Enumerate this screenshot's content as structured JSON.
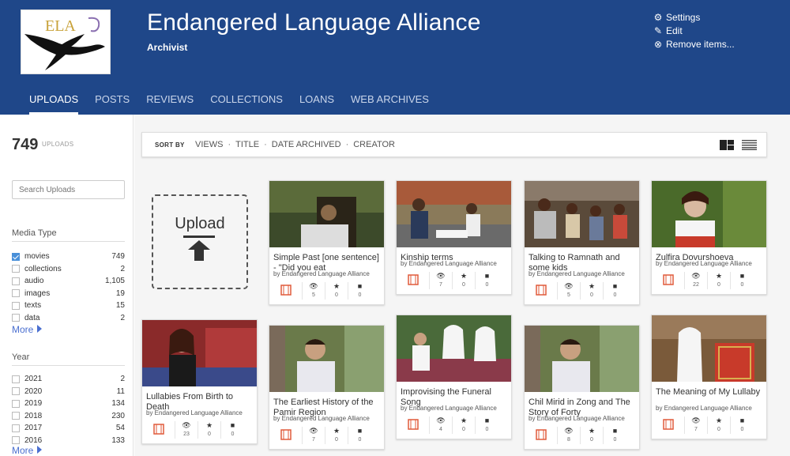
{
  "header": {
    "logo_text": "ELA",
    "title": "Endangered Language Alliance",
    "subtitle": "Archivist",
    "actions": [
      {
        "label": "Settings",
        "icon": "gear-icon"
      },
      {
        "label": "Edit",
        "icon": "pencil-icon"
      },
      {
        "label": "Remove items...",
        "icon": "remove-icon"
      }
    ]
  },
  "tabs": [
    "UPLOADS",
    "POSTS",
    "REVIEWS",
    "COLLECTIONS",
    "LOANS",
    "WEB ARCHIVES"
  ],
  "sidebar": {
    "count": "749",
    "count_label": "UPLOADS",
    "search_placeholder": "Search Uploads",
    "media_type": {
      "title": "Media Type",
      "items": [
        {
          "name": "movies",
          "count": "749",
          "checked": true
        },
        {
          "name": "collections",
          "count": "2",
          "checked": false
        },
        {
          "name": "audio",
          "count": "1,105",
          "checked": false
        },
        {
          "name": "images",
          "count": "19",
          "checked": false
        },
        {
          "name": "texts",
          "count": "15",
          "checked": false
        },
        {
          "name": "data",
          "count": "2",
          "checked": false
        }
      ],
      "more": "More"
    },
    "year": {
      "title": "Year",
      "items": [
        {
          "name": "2021",
          "count": "2"
        },
        {
          "name": "2020",
          "count": "11"
        },
        {
          "name": "2019",
          "count": "134"
        },
        {
          "name": "2018",
          "count": "230"
        },
        {
          "name": "2017",
          "count": "54"
        },
        {
          "name": "2016",
          "count": "133"
        }
      ],
      "more": "More"
    }
  },
  "sortbar": {
    "label": "SORT BY",
    "options": [
      "VIEWS",
      "TITLE",
      "DATE ARCHIVED",
      "CREATOR"
    ]
  },
  "upload_label": "Upload",
  "items": [
    {
      "title": "Simple Past [one sentence] - \"Did you eat",
      "by": "by Endangered Language Alliance",
      "views": "5",
      "favs": "0",
      "reviews": "0"
    },
    {
      "title": "Kinship terms",
      "by": "by Endangered Language Alliance",
      "views": "7",
      "favs": "0",
      "reviews": "0"
    },
    {
      "title": "Talking to Ramnath and some kids",
      "by": "by Endangered Language Alliance",
      "views": "5",
      "favs": "0",
      "reviews": "0"
    },
    {
      "title": "Zulfira Dovurshoeva",
      "by": "by Endangered Language Alliance",
      "views": "22",
      "favs": "0",
      "reviews": "0"
    },
    {
      "title": "Lullabies From Birth to Death",
      "by": "by Endangered Language Alliance",
      "views": "23",
      "favs": "0",
      "reviews": "0"
    },
    {
      "title": "The Earliest History of the Pamir Region",
      "by": "by Endangered Language Alliance",
      "views": "7",
      "favs": "0",
      "reviews": "0"
    },
    {
      "title": "Improvising the Funeral Song",
      "by": "by Endangered Language Alliance",
      "views": "4",
      "favs": "0",
      "reviews": "0"
    },
    {
      "title": "Chil Mirid in Zong and The Story of Forty",
      "by": "by Endangered Language Alliance",
      "views": "8",
      "favs": "0",
      "reviews": "0"
    },
    {
      "title": "The Meaning of My Lullaby",
      "by": "by Endangered Language Alliance",
      "views": "7",
      "favs": "0",
      "reviews": "0"
    }
  ]
}
